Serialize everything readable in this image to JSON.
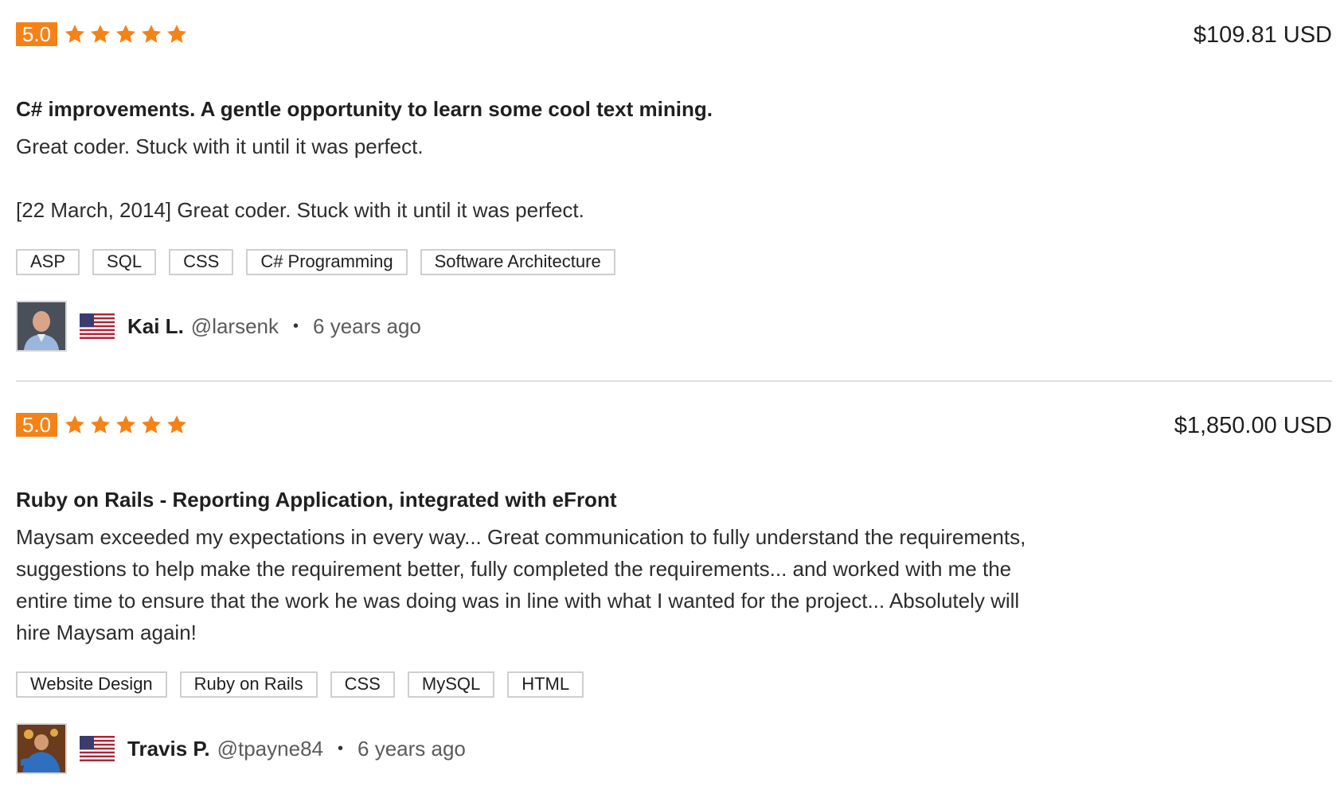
{
  "colors": {
    "accent": "#f58216",
    "tag_border": "#cfcfcf",
    "divider": "#dedede"
  },
  "reviews": [
    {
      "rating": "5.0",
      "stars": 5,
      "price": "$109.81 USD",
      "title": "C# improvements. A gentle opportunity to learn some cool text mining.",
      "paragraphs": [
        "Great coder. Stuck with it until it was perfect.",
        "[22 March, 2014] Great coder. Stuck with it until it was perfect."
      ],
      "tags": [
        "ASP",
        "SQL",
        "CSS",
        "C# Programming",
        "Software Architecture"
      ],
      "reviewer": {
        "name": "Kai L.",
        "handle": "@larsenk",
        "separator": "•",
        "time": "6 years ago",
        "avatar_icon": "user-avatar-photo",
        "flag_icon": "us-flag-icon"
      }
    },
    {
      "rating": "5.0",
      "stars": 5,
      "price": "$1,850.00 USD",
      "title": "Ruby on Rails - Reporting Application, integrated with eFront",
      "paragraphs": [
        "Maysam exceeded my expectations in every way... Great communication to fully understand the requirements, suggestions to help make the requirement better, fully completed the requirements... and worked with me the entire time to ensure that the work he was doing was in line with what I wanted for the project... Absolutely will hire Maysam again!"
      ],
      "tags": [
        "Website Design",
        "Ruby on Rails",
        "CSS",
        "MySQL",
        "HTML"
      ],
      "reviewer": {
        "name": "Travis P.",
        "handle": "@tpayne84",
        "separator": "•",
        "time": "6 years ago",
        "avatar_icon": "user-avatar-photo",
        "flag_icon": "us-flag-icon"
      }
    }
  ]
}
